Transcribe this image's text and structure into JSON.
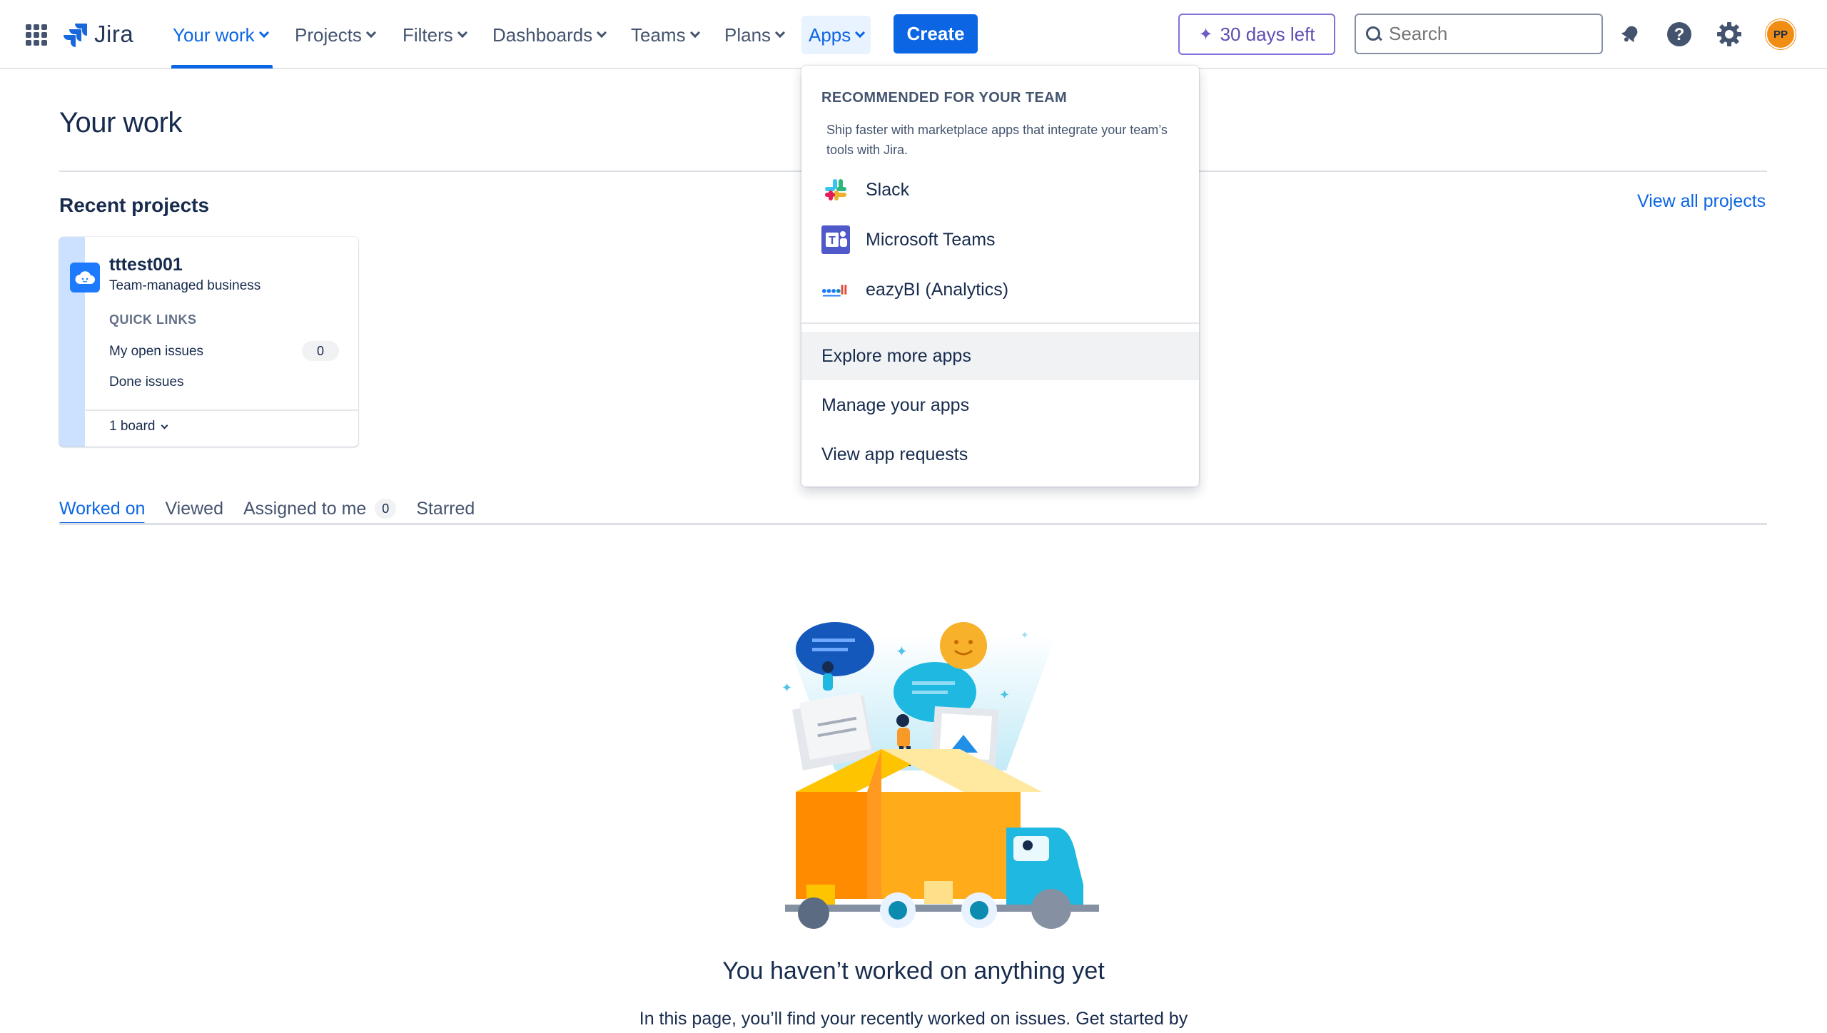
{
  "nav": {
    "logo_text": "Jira",
    "items": [
      {
        "label": "Your work"
      },
      {
        "label": "Projects"
      },
      {
        "label": "Filters"
      },
      {
        "label": "Dashboards"
      },
      {
        "label": "Teams"
      },
      {
        "label": "Plans"
      },
      {
        "label": "Apps"
      }
    ],
    "create_label": "Create",
    "trial_label": "30 days left",
    "search_placeholder": "Search",
    "avatar_initials": "PP",
    "accent_color": "#0c66e4"
  },
  "page": {
    "title": "Your work",
    "recent_projects_title": "Recent projects",
    "view_all_label": "View all projects"
  },
  "project_card": {
    "name": "tttest001",
    "type": "Team-managed business",
    "quick_links_label": "QUICK LINKS",
    "links": [
      {
        "label": "My open issues",
        "count": "0"
      },
      {
        "label": "Done issues"
      }
    ],
    "boards_label": "1 board"
  },
  "tabs": [
    {
      "label": "Worked on"
    },
    {
      "label": "Viewed"
    },
    {
      "label": "Assigned to me",
      "badge": "0"
    },
    {
      "label": "Starred"
    }
  ],
  "empty_state": {
    "title": "You haven’t worked on anything yet",
    "description": "In this page, you’ll find your recently worked on issues. Get started by"
  },
  "apps_menu": {
    "heading": "RECOMMENDED FOR YOUR TEAM",
    "description": "Ship faster with marketplace apps that integrate your team’s tools with Jira.",
    "apps": [
      {
        "label": "Slack",
        "icon": "slack-icon"
      },
      {
        "label": "Microsoft Teams",
        "icon": "microsoft-teams-icon"
      },
      {
        "label": "eazyBI (Analytics)",
        "icon": "eazybi-icon"
      }
    ],
    "links": [
      {
        "label": "Explore more apps"
      },
      {
        "label": "Manage your apps"
      },
      {
        "label": "View app requests"
      }
    ]
  }
}
